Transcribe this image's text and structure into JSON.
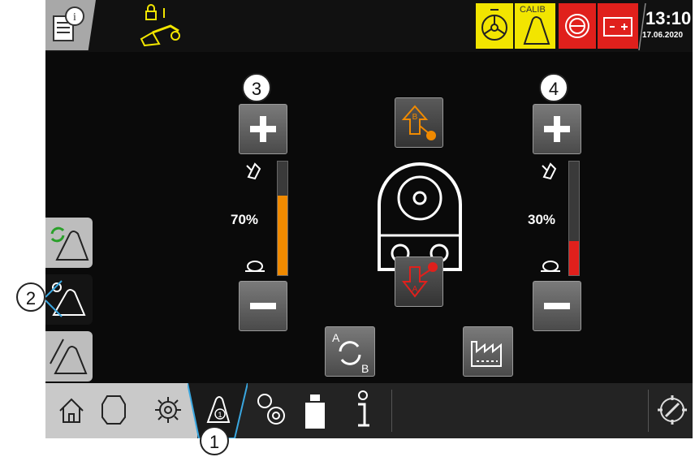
{
  "status": {
    "time": "13:10",
    "date": "17.06.2020",
    "calib_label": "CALIB",
    "colors": {
      "warning": "#f2e500",
      "alarm": "#e0201c",
      "orange": "#f08a00"
    }
  },
  "callouts": {
    "c1": "1",
    "c2": "2",
    "c3": "3",
    "c4": "4"
  },
  "left_control": {
    "percent": "70%",
    "fill_fraction": 0.7,
    "color": "#f08a00"
  },
  "right_control": {
    "percent": "30%",
    "fill_fraction": 0.3,
    "color": "#e0201c"
  },
  "labels": {
    "a": "A",
    "b": "B"
  },
  "icons": [
    "info-log-icon",
    "lock-excavator-icon",
    "steering-wheel-icon",
    "calib-icon",
    "brake-alarm-icon",
    "battery-icon",
    "plus-icon",
    "minus-icon",
    "fast-mode-icon",
    "slow-turtle-icon",
    "arrow-b-icon",
    "arrow-a-icon",
    "swap-ab-icon",
    "factory-icon",
    "home-icon",
    "engine-icon",
    "gear-icon",
    "bucket-icon",
    "gears-icon",
    "weight-icon",
    "info-icon",
    "settings-icon"
  ]
}
